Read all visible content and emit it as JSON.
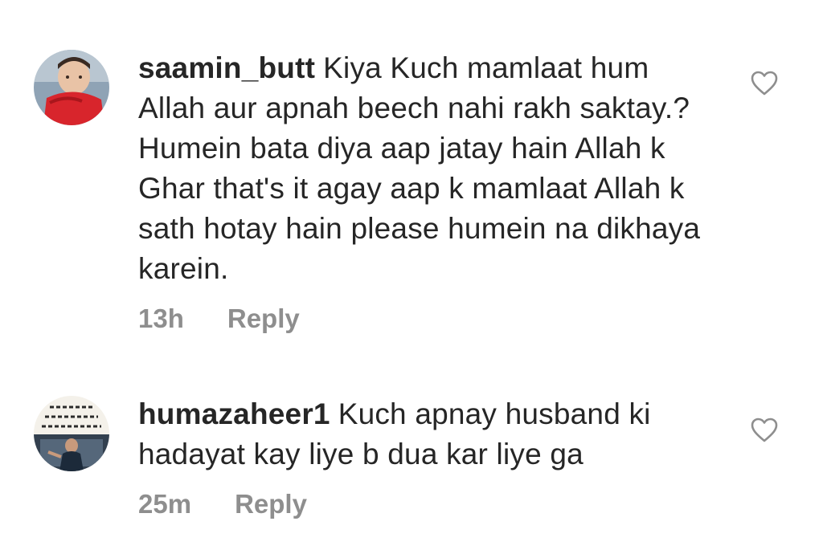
{
  "comments": [
    {
      "username": "saamin_butt",
      "text": "Kiya Kuch mamlaat hum Allah aur apnah beech nahi rakh saktay.? Humein bata diya aap jatay hain Allah k Ghar that's it agay aap k mamlaat Allah k sath hotay hain please humein na dikhaya karein.",
      "time": "13h",
      "reply_label": "Reply",
      "avatar_icon": "child-photo-avatar",
      "like_icon": "heart-outline-icon"
    },
    {
      "username": "humazaheer1",
      "text": "Kuch apnay husband ki hadayat kay liye b dua kar liye ga",
      "time": "25m",
      "reply_label": "Reply",
      "avatar_icon": "urdu-poster-avatar",
      "like_icon": "heart-outline-icon"
    }
  ],
  "colors": {
    "text": "#262626",
    "meta": "#8e8e8e",
    "heart": "#8e8e8e"
  }
}
